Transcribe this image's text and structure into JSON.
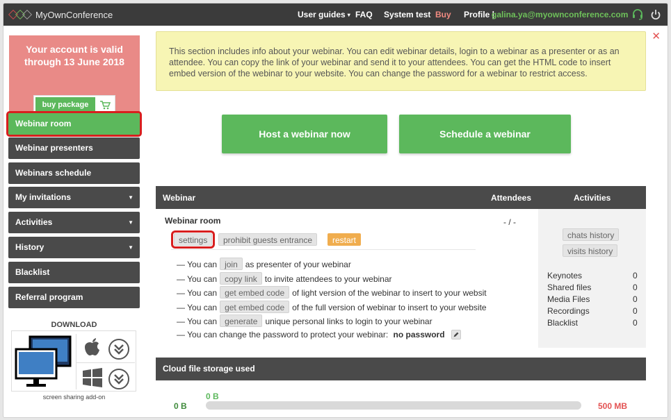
{
  "topbar": {
    "logo_text": "MyOwnConference",
    "nav": {
      "user_guides": "User guides",
      "faq": "FAQ",
      "system_test": "System test",
      "buy": "Buy",
      "profile": "Profile |",
      "email": "galina.ya@myownconference.com"
    },
    "icons": [
      "headset-icon",
      "power-icon"
    ]
  },
  "sidebar": {
    "account_text": "Your account is valid through 13 June 2018",
    "buy_package": "buy package",
    "items": [
      {
        "label": "Webinar room",
        "active": true
      },
      {
        "label": "Webinar presenters"
      },
      {
        "label": "Webinars schedule"
      },
      {
        "label": "My invitations",
        "dropdown": true
      },
      {
        "label": "Activities",
        "dropdown": true
      },
      {
        "label": "History",
        "dropdown": true
      },
      {
        "label": "Blacklist"
      },
      {
        "label": "Referral program"
      }
    ],
    "download_title": "DOWNLOAD",
    "download_caption": "screen sharing add-on"
  },
  "info_text": "This section includes info about your webinar. You can edit webinar details, login to a webinar as a presenter or as an attendee. You can copy the link of your webinar and send it to your attendees. You can get the HTML code to insert embed version of the webinar to your website. You can change the password for a webinar to restrict access.",
  "buttons": {
    "host": "Host a webinar now",
    "schedule": "Schedule a webinar"
  },
  "table": {
    "headers": {
      "webinar": "Webinar",
      "attendees": "Attendees",
      "activities": "Activities"
    },
    "room_title": "Webinar room",
    "attendees_value": "- / -",
    "tags": {
      "settings": "settings",
      "prohibit": "prohibit guests entrance",
      "restart": "restart"
    },
    "lines": [
      {
        "pre": "— You can",
        "tag": "join",
        "post": "as presenter of your webinar"
      },
      {
        "pre": "— You can",
        "tag": "copy link",
        "post": "to invite attendees to your webinar"
      },
      {
        "pre": "— You can",
        "tag": "get embed code",
        "post": "of light version of the webinar to insert to your websit"
      },
      {
        "pre": "— You can",
        "tag": "get embed code",
        "post": "of the full version of webinar to insert to your website"
      },
      {
        "pre": "— You can",
        "tag": "generate",
        "post": "unique personal links to login to your webinar"
      }
    ],
    "password_line": "— You can change the password to protect your webinar:",
    "password_value": "no password",
    "activity_buttons": {
      "chats": "chats history",
      "visits": "visits history"
    },
    "stats": [
      {
        "label": "Keynotes",
        "value": "0"
      },
      {
        "label": "Shared files",
        "value": "0"
      },
      {
        "label": "Media Files",
        "value": "0"
      },
      {
        "label": "Recordings",
        "value": "0"
      },
      {
        "label": "Blacklist",
        "value": "0"
      }
    ]
  },
  "storage": {
    "title": "Cloud file storage used",
    "min_label": "0 B",
    "used_label": "0 B",
    "max_label": "500 MB",
    "used_fraction": 0
  },
  "colors": {
    "accent_green": "#5cb85c",
    "dark": "#4a4a4a",
    "alert_red": "#e35252",
    "info_bg": "#f7f5b4"
  }
}
